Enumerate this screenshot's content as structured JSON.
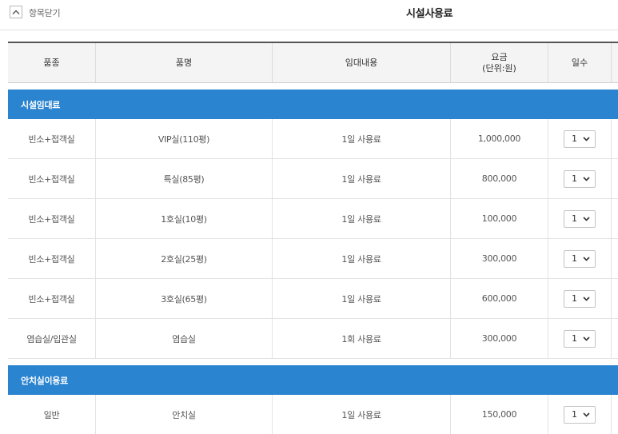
{
  "header": {
    "collapse_label": "항목닫기",
    "title": "시설사용료"
  },
  "table": {
    "columns": {
      "category": "품종",
      "item": "품명",
      "rental": "임대내용",
      "fee": "요금",
      "fee_unit": "(단위:원)",
      "days": "일수"
    },
    "groups": [
      {
        "label": "시설임대료",
        "rows": [
          {
            "category": "빈소+접객실",
            "item": "VIP실(110평)",
            "rental": "1일 사용료",
            "fee": "1,000,000",
            "days": "1"
          },
          {
            "category": "빈소+접객실",
            "item": "특실(85평)",
            "rental": "1일 사용료",
            "fee": "800,000",
            "days": "1"
          },
          {
            "category": "빈소+접객실",
            "item": "1호실(10평)",
            "rental": "1일 사용료",
            "fee": "100,000",
            "days": "1"
          },
          {
            "category": "빈소+접객실",
            "item": "2호실(25평)",
            "rental": "1일 사용료",
            "fee": "300,000",
            "days": "1"
          },
          {
            "category": "빈소+접객실",
            "item": "3호실(65평)",
            "rental": "1일 사용료",
            "fee": "600,000",
            "days": "1"
          },
          {
            "category": "염습실/입관실",
            "item": "염습실",
            "rental": "1회 사용료",
            "fee": "300,000",
            "days": "1"
          }
        ]
      },
      {
        "label": "안치실이용료",
        "rows": [
          {
            "category": "일반",
            "item": "안치실",
            "rental": "1일 사용료",
            "fee": "150,000",
            "days": "1"
          }
        ]
      }
    ]
  },
  "icons": {
    "collapse": "chevron-up-icon",
    "dropdown": "chevron-down-icon"
  },
  "colors": {
    "group_header": "#2a84cf"
  }
}
